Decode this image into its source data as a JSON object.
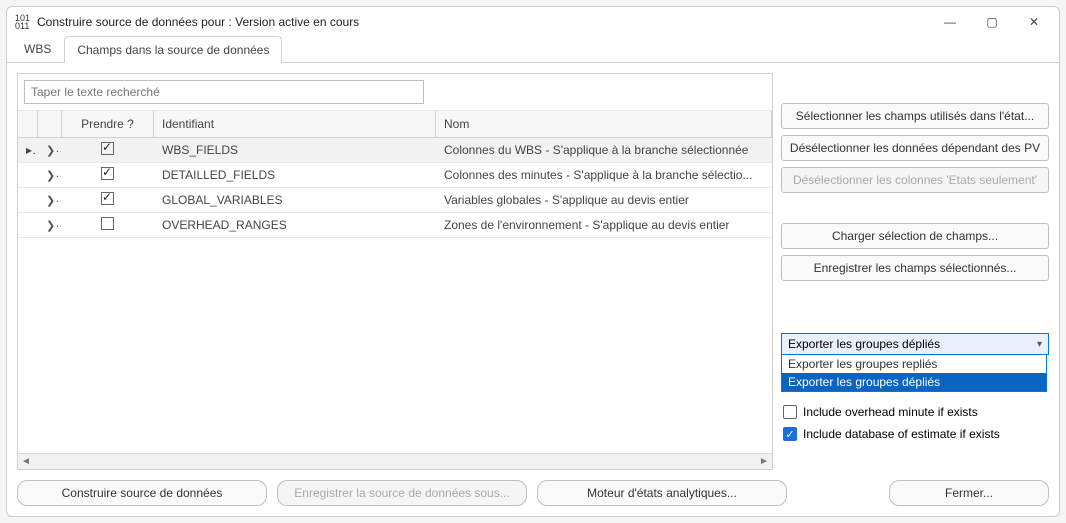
{
  "titlebar": {
    "title": "Construire source de données pour : Version active en cours"
  },
  "tabs": {
    "wbs": "WBS",
    "fields": "Champs dans la source de données"
  },
  "search": {
    "placeholder": "Taper le texte recherché"
  },
  "grid": {
    "headers": {
      "take": "Prendre ?",
      "id": "Identifiant",
      "name": "Nom"
    },
    "rows": [
      {
        "indicator": "▸",
        "checked": true,
        "id": "WBS_FIELDS",
        "name": "Colonnes du WBS - S'applique à la branche sélectionnée"
      },
      {
        "indicator": "",
        "checked": true,
        "id": "DETAILLED_FIELDS",
        "name": "Colonnes des minutes - S'applique à la branche sélectio..."
      },
      {
        "indicator": "",
        "checked": true,
        "id": "GLOBAL_VARIABLES",
        "name": "Variables globales - S'applique au devis entier"
      },
      {
        "indicator": "",
        "checked": false,
        "id": "OVERHEAD_RANGES",
        "name": "Zones de l'environnement - S'applique au devis entier"
      }
    ]
  },
  "side": {
    "select_used": "Sélectionner les champs utilisés dans l'état...",
    "deselect_pv": "Désélectionner les données dépendant des PV",
    "deselect_states": "Désélectionner les colonnes 'Etats seulement'",
    "load_sel": "Charger sélection de champs...",
    "save_sel": "Enregistrer les champs sélectionnés..."
  },
  "combo": {
    "selected": "Exporter les groupes dépliés",
    "options": [
      "Exporter les groupes repliés",
      "Exporter les groupes dépliés"
    ]
  },
  "checks": {
    "overhead": "Include overhead minute if exists",
    "database": "Include database of estimate if exists"
  },
  "footer": {
    "build": "Construire source de données",
    "save_as": "Enregistrer la source de données sous...",
    "engine": "Moteur d'états analytiques...",
    "close": "Fermer..."
  }
}
